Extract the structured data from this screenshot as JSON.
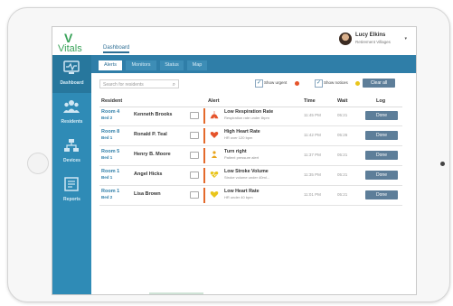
{
  "app": {
    "logo_mark": "V",
    "logo_text": "Vitals",
    "nav_tab": "Dashboard"
  },
  "user": {
    "name": "Lucy Elkins",
    "org": "Retirement Villages"
  },
  "sidebar": {
    "items": [
      {
        "label": "Dashboard",
        "icon": "monitor-icon"
      },
      {
        "label": "Residents",
        "icon": "people-icon"
      },
      {
        "label": "Devices",
        "icon": "network-icon"
      },
      {
        "label": "Reports",
        "icon": "report-icon"
      }
    ]
  },
  "tabs": [
    {
      "label": "Alerts"
    },
    {
      "label": "Monitors"
    },
    {
      "label": "Status"
    },
    {
      "label": "Map"
    }
  ],
  "filters": {
    "search_placeholder": "Search for residents",
    "show_urgent": "Show urgent",
    "show_notices": "Show notices",
    "urgent_color": "#e5532a",
    "notice_color": "#e9c51b",
    "clear_label": "Clear all"
  },
  "table": {
    "headers": {
      "resident": "Resident",
      "alert": "Alert",
      "time": "Time",
      "wait": "Wait",
      "log": "Log"
    },
    "rows": [
      {
        "room": "Room 4",
        "bed": "Bed 2",
        "name": "Kenneth Brooks",
        "alert": "Low Respiration Rate",
        "sub": "Respiration rate under 8rpm",
        "time": "11:45 PM",
        "wait": "05:21",
        "action": "Done",
        "icon_color": "#e5532a"
      },
      {
        "room": "Room 8",
        "bed": "Bed 1",
        "name": "Ronald P. Teal",
        "alert": "High Heart Rate",
        "sub": "HR over 120 bpm",
        "time": "11:42 PM",
        "wait": "05:26",
        "action": "Done",
        "icon_color": "#e5532a"
      },
      {
        "room": "Room 5",
        "bed": "Bed 1",
        "name": "Henry B. Moore",
        "alert": "Turn right",
        "sub": "Patient pressure alert",
        "time": "11:37 PM",
        "wait": "05:21",
        "action": "Done",
        "icon_color": "#e9a51b"
      },
      {
        "room": "Room 1",
        "bed": "Bed 1",
        "name": "Angel Hicks",
        "alert": "Low Stroke Volume",
        "sub": "Stroke volume under 40ml...",
        "time": "11:35 PM",
        "wait": "05:21",
        "action": "Done",
        "icon_color": "#e9c51b"
      },
      {
        "room": "Room 1",
        "bed": "Bed 2",
        "name": "Lisa Brown",
        "alert": "Low Heart Rate",
        "sub": "HR under 40 bpm",
        "time": "11:01 PM",
        "wait": "05:21",
        "action": "Done",
        "icon_color": "#e9c51b"
      }
    ]
  }
}
